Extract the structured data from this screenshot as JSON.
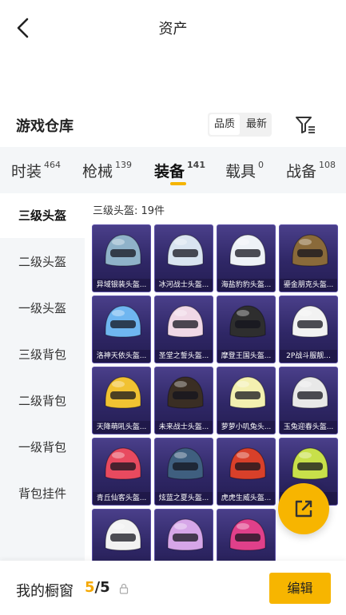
{
  "header": {
    "title": "资产"
  },
  "warehouse": {
    "title": "游戏仓库",
    "sort_options": [
      "品质",
      "最新"
    ]
  },
  "tabs": [
    {
      "label": "时装",
      "count": "464"
    },
    {
      "label": "枪械",
      "count": "139"
    },
    {
      "label": "装备",
      "count": "141"
    },
    {
      "label": "载具",
      "count": "0"
    },
    {
      "label": "战备",
      "count": "108"
    }
  ],
  "sidebar": {
    "items": [
      "三级头盔",
      "二级头盔",
      "一级头盔",
      "三级背包",
      "二级背包",
      "一级背包",
      "背包挂件"
    ]
  },
  "content": {
    "count_label": "三级头盔: 19件",
    "items": [
      {
        "name": "异域银装头盔...",
        "color": "#8fb2c9"
      },
      {
        "name": "冰河战士头盔...",
        "color": "#d9e4f0"
      },
      {
        "name": "海盐豹豹头盔...",
        "color": "#eef2f7"
      },
      {
        "name": "鎏金朋克头盔...",
        "color": "#8a6a3a"
      },
      {
        "name": "洛神天依头盔...",
        "color": "#6fb6f0"
      },
      {
        "name": "圣堂之誓头盔...",
        "color": "#f0d8e6"
      },
      {
        "name": "摩登王国头盔...",
        "color": "#2e2e2e"
      },
      {
        "name": "2P战斗服靓...",
        "color": "#f2f2f2"
      },
      {
        "name": "天降萌吼头盔...",
        "color": "#f1c232"
      },
      {
        "name": "未来战士头盔...",
        "color": "#3a2e24"
      },
      {
        "name": "萝萝小叽兔头...",
        "color": "#f3f0b0"
      },
      {
        "name": "玉兔迎春头盔...",
        "color": "#e8e8e8"
      },
      {
        "name": "青丘仙客头盔...",
        "color": "#e84a5f"
      },
      {
        "name": "炫蓝之夏头盔...",
        "color": "#3f5f7f"
      },
      {
        "name": "虎虎生威头盔...",
        "color": "#d8402a"
      },
      {
        "name": "...",
        "color": "#c8e04a"
      },
      {
        "name": "",
        "color": "#f2f2f2"
      },
      {
        "name": "",
        "color": "#d6a6e8"
      },
      {
        "name": "",
        "color": "#e0408a"
      }
    ]
  },
  "showcase": {
    "label": "我的橱窗",
    "current": "5",
    "total": "/5",
    "edit_label": "编辑"
  },
  "colors": {
    "accent": "#f7b500",
    "current_count": "#f5a800"
  }
}
